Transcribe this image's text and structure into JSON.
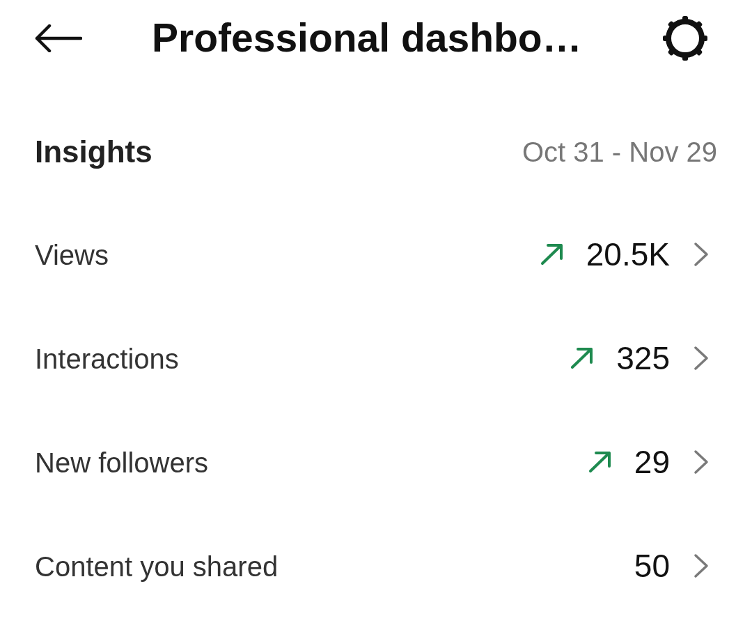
{
  "header": {
    "title": "Professional dashbo…"
  },
  "insights": {
    "title": "Insights",
    "date_range": "Oct 31 - Nov 29"
  },
  "metrics": [
    {
      "label": "Views",
      "value": "20.5K",
      "trend_up": true
    },
    {
      "label": "Interactions",
      "value": "325",
      "trend_up": true
    },
    {
      "label": "New followers",
      "value": "29",
      "trend_up": true
    },
    {
      "label": "Content you shared",
      "value": "50",
      "trend_up": false
    }
  ]
}
